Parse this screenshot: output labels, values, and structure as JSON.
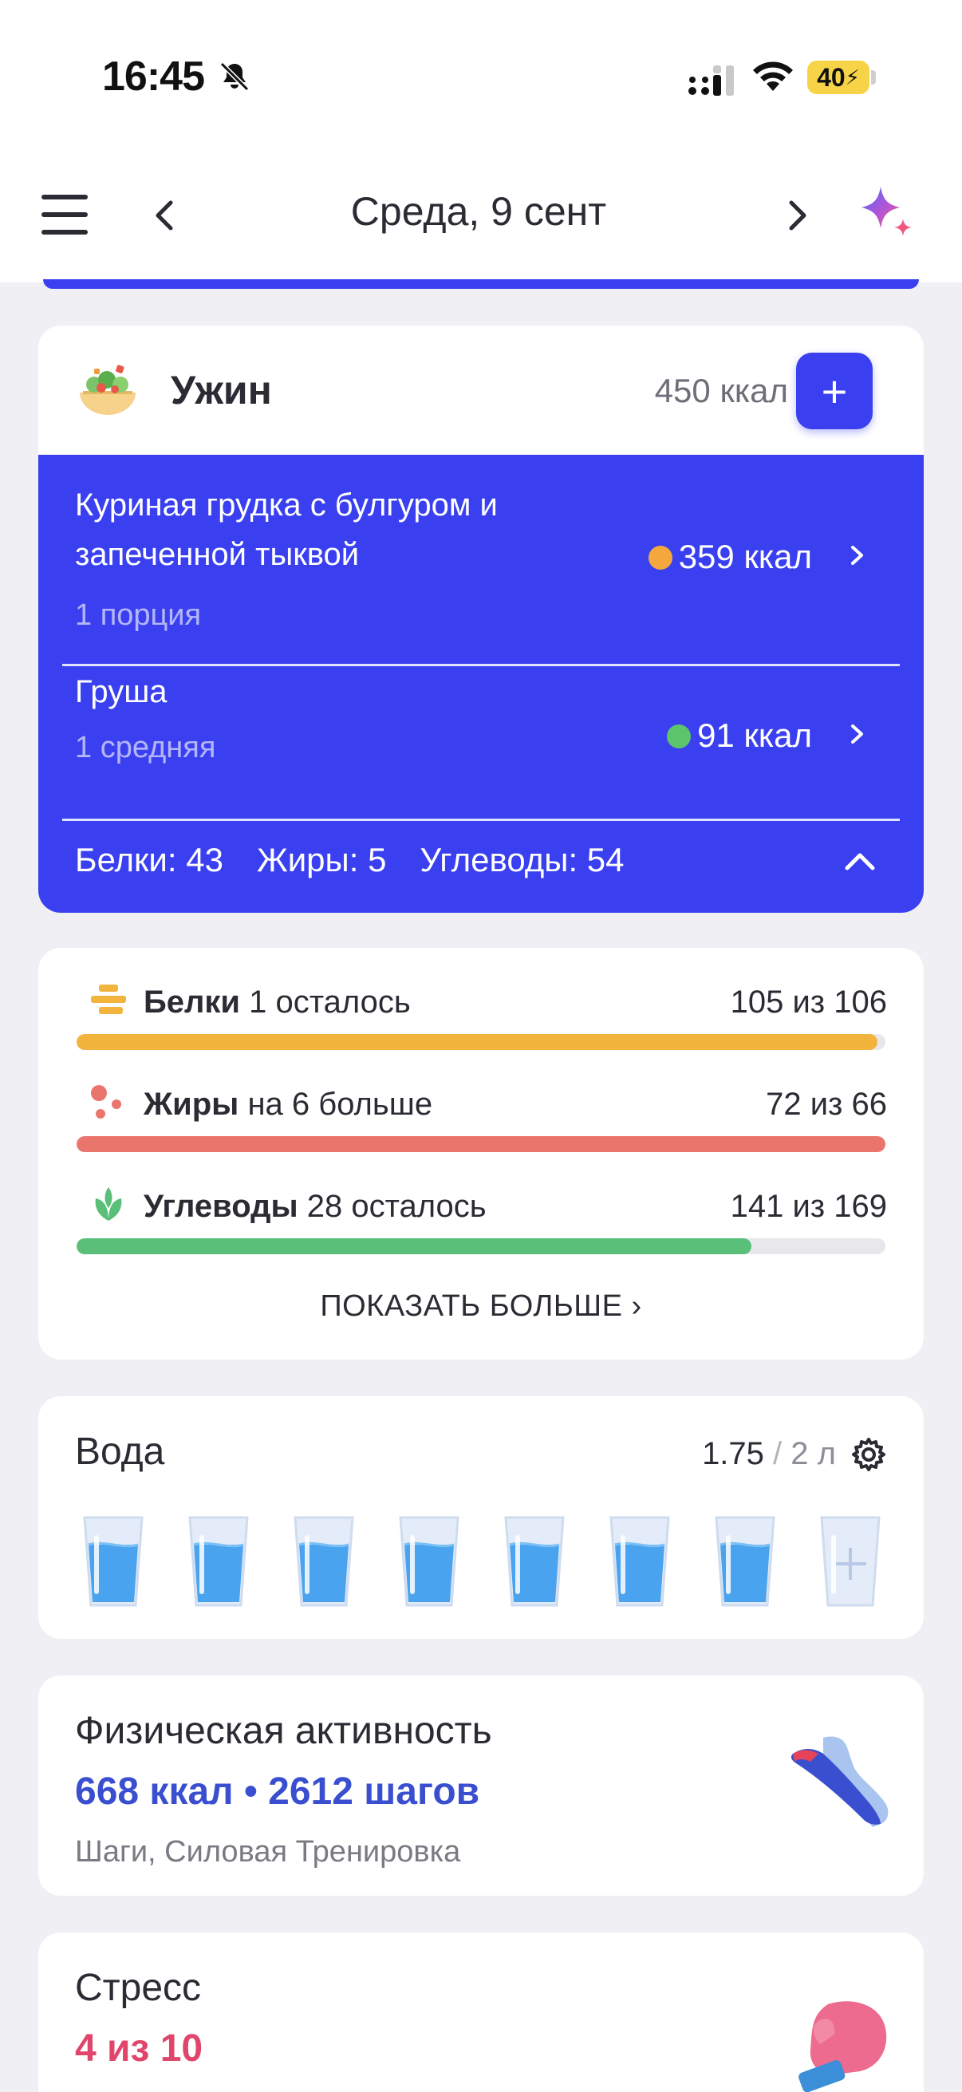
{
  "status_bar": {
    "time": "16:45",
    "battery": "40",
    "icons": [
      "bell-slash-icon",
      "cellular-signal-icon",
      "wifi-icon",
      "battery-charging-icon"
    ]
  },
  "header": {
    "title": "Среда, 9 сент",
    "icons": [
      "menu-icon",
      "chevron-left-icon",
      "chevron-right-icon",
      "sparkle-icon"
    ]
  },
  "dinner": {
    "title": "Ужин",
    "kcal": "450 ккал",
    "add_label": "+",
    "items": [
      {
        "name_line1": "Куриная грудка с булгуром и",
        "name_line2": "запеченной тыквой",
        "portion": "1 порция",
        "kcal": "359 ккал",
        "dot_color": "#f4a73c"
      },
      {
        "name_line1": "Груша",
        "portion": "1 средняя",
        "kcal": "91 ккал",
        "dot_color": "#5cc46a"
      }
    ],
    "macros": {
      "protein": "Белки: 43",
      "fat": "Жиры: 5",
      "carbs": "Углеводы: 54"
    }
  },
  "nutrients": {
    "rows": [
      {
        "name": "Белки",
        "status": "1 осталось",
        "value": "105 из 106",
        "progress": 0.99,
        "color": "#f2b43c"
      },
      {
        "name": "Жиры",
        "status": "на 6 больше",
        "value": "72 из 66",
        "progress": 1.0,
        "color": "#ea756d"
      },
      {
        "name": "Углеводы",
        "status": "28 осталось",
        "value": "141 из 169",
        "progress": 0.834,
        "color": "#5abf78"
      }
    ],
    "show_more": "ПОКАЗАТЬ БОЛЬШЕ ›"
  },
  "water": {
    "title": "Вода",
    "amount": "1.75",
    "separator": "/",
    "goal": "2 л",
    "glasses_filled": 7,
    "glasses_total": 8
  },
  "activity": {
    "title": "Физическая активность",
    "stats": "668 ккал • 2612 шагов",
    "subtitle": "Шаги, Силовая Тренировка"
  },
  "stress": {
    "title": "Стресс",
    "value": "4 из 10"
  }
}
